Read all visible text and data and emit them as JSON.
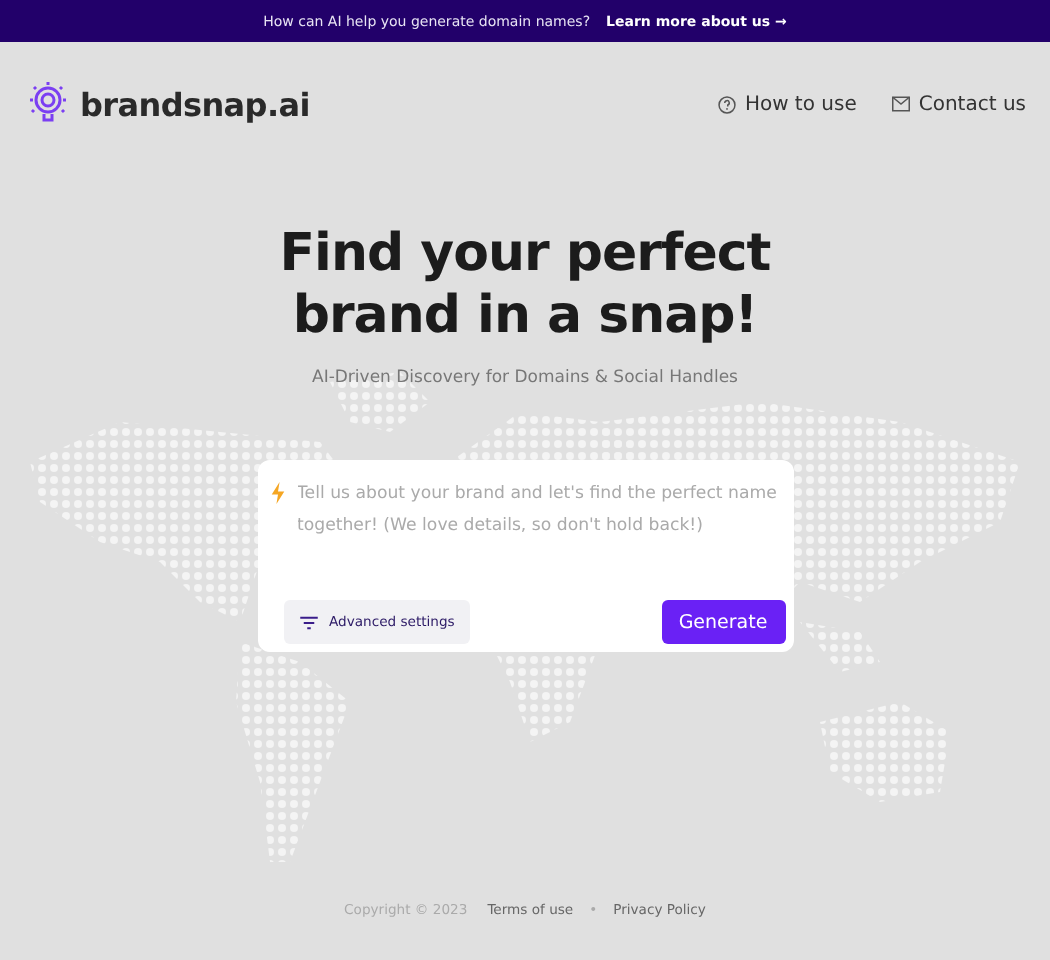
{
  "banner": {
    "text": "How can AI help you generate domain names?",
    "link": "Learn more about us →"
  },
  "header": {
    "logo": "brandsnap.ai",
    "nav": [
      {
        "kind": "help",
        "label": "How to use"
      },
      {
        "kind": "mail",
        "label": "Contact us"
      }
    ]
  },
  "hero": {
    "title_lines": [
      "Find your perfect",
      "brand in a snap!"
    ],
    "subtitle": "AI-Driven Discovery for Domains & Social Handles"
  },
  "prompt": {
    "placeholder": "Tell us about your brand and let's find the perfect name together! (We love details, so don't hold back!)",
    "settings_button": "Advanced settings",
    "submit_button": "Generate"
  },
  "footer": {
    "copyright": "Copyright © 2023",
    "links": [
      "Terms of use",
      "Privacy Policy"
    ],
    "separator": "•"
  }
}
